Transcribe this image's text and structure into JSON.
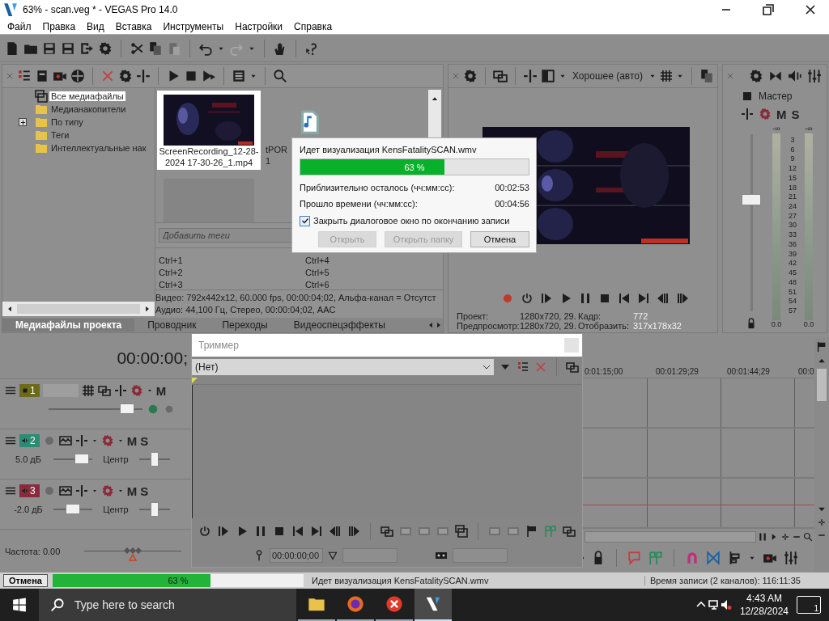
{
  "window": {
    "title": "63% - scan.veg * - VEGAS Pro 14.0"
  },
  "menu": [
    "Файл",
    "Правка",
    "Вид",
    "Вставка",
    "Инструменты",
    "Настройки",
    "Справка"
  ],
  "explorer": {
    "tree": [
      {
        "label": "Все медиафайлы",
        "selected": true
      },
      {
        "label": "Медианакопители",
        "selected": false
      },
      {
        "label": "По типу",
        "selected": false,
        "expanded": false
      },
      {
        "label": "Теги",
        "selected": false
      },
      {
        "label": "Интеллектуальные нак",
        "selected": false
      }
    ],
    "media": [
      {
        "kind": "video",
        "lines": [
          "ScreenRecording_12-28-",
          "2024 17-30-26_1.mp4"
        ],
        "selected": true
      },
      {
        "kind": "audio",
        "lines": [
          "tPOR",
          "1"
        ],
        "selected": false
      },
      {
        "kind": "empty",
        "selected": false
      }
    ],
    "tags_placeholder": "Добавить теги",
    "shortcuts": [
      "Ctrl+1",
      "Ctrl+2",
      "Ctrl+3",
      "Ctrl+4",
      "Ctrl+5",
      "Ctrl+6"
    ],
    "info": [
      "Видео: 792x442x12, 60.000 fps, 00:00:04;02, Альфа-канал = Отсутст",
      "Аудио: 44,100 Гц, Стерео, 00:00:04;02, AAC"
    ],
    "tabs": [
      {
        "label": "Медиафайлы проекта",
        "selected": true
      },
      {
        "label": "Проводник",
        "selected": false
      },
      {
        "label": "Переходы",
        "selected": false
      },
      {
        "label": "Видеоспецэффекты",
        "selected": false
      }
    ]
  },
  "preview": {
    "quality": "Хорошее (авто)",
    "stats": [
      {
        "label": "Проект:",
        "value": "1280x720, 29.",
        "label2": "Кадр:",
        "value2": "772"
      },
      {
        "label": "Предпросмотр:",
        "value": "1280x720, 29.",
        "label2": "Отобразить:",
        "value2": "317x178x32"
      }
    ]
  },
  "master": {
    "label": "Мастер",
    "mute": "M",
    "solo": "S",
    "peaks": [
      "-∞",
      "-∞"
    ],
    "scale": [
      "3",
      "6",
      "9",
      "12",
      "15",
      "18",
      "21",
      "24",
      "27",
      "30",
      "33",
      "36",
      "39",
      "42",
      "45",
      "48",
      "51",
      "54",
      "57"
    ],
    "readings": [
      "0.0",
      "0.0"
    ],
    "fader": {
      "level": 0.64
    }
  },
  "timeline": {
    "time": "00:00:00;",
    "tracks": [
      {
        "kind": "video",
        "number": "1",
        "color": "#6e6a1c",
        "mute": "M",
        "volume": {
          "level": 0.9
        }
      },
      {
        "kind": "audio",
        "number": "2",
        "color": "#2e8a72",
        "mute": "M",
        "solo": "S",
        "volume": {
          "reading": "5.0 дБ",
          "level": 0.85
        },
        "pan": {
          "reading": "Центр",
          "level": 0.5
        }
      },
      {
        "kind": "audio",
        "number": "3",
        "color": "#8a2a3c",
        "mute": "M",
        "solo": "S",
        "volume": {
          "reading": "-2.0 дБ",
          "level": 0.5
        },
        "pan": {
          "reading": "Центр",
          "level": 0.5
        }
      }
    ],
    "ruler": [
      "0:01:15;00",
      "00:01:29;29",
      "00:01:44;29",
      "00:0"
    ],
    "rate": {
      "label": "Частота: 0.00",
      "level": 0.5
    }
  },
  "render_dialog": {
    "message": "Идет визуализация KensFatalitySCAN.wmv",
    "progress": {
      "level": 0.63,
      "text": "63 %"
    },
    "rows": [
      {
        "label": "Приблизительно осталось (чч:мм:сс):",
        "value": "00:02:53"
      },
      {
        "label": "Прошло времени (чч:мм:сс):",
        "value": "00:04:56"
      }
    ],
    "close_on_finish": {
      "label": "Закрыть диалоговое окно по окончанию записи",
      "checked": true
    },
    "buttons": [
      {
        "label": "Открыть",
        "disabled": true
      },
      {
        "label": "Открыть папку",
        "disabled": true
      },
      {
        "label": "Отмена",
        "disabled": false
      }
    ]
  },
  "trimmer": {
    "title": "Триммер",
    "source": "(Нет)",
    "time": "00:00:00;00"
  },
  "status_bar": {
    "cancel": "Отмена",
    "progress": {
      "level": 0.63,
      "text": "63 %"
    },
    "message": "Идет визуализация KensFatalitySCAN.wmv",
    "record_time": "Время записи (2 каналов): 116:11:35"
  },
  "taskbar": {
    "search_placeholder": "Type here to search",
    "apps": [
      {
        "kind": "folder",
        "selected": false
      },
      {
        "kind": "browser",
        "selected": false
      },
      {
        "kind": "error",
        "selected": false
      },
      {
        "kind": "editor",
        "selected": true
      }
    ],
    "time": "4:43 AM",
    "date": "12/28/2024",
    "notifications": "1"
  }
}
